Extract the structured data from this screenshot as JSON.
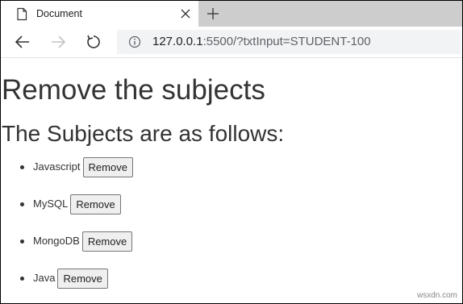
{
  "browser": {
    "tab": {
      "title": "Document"
    },
    "address_bar": {
      "url_host": "127.0.0.1",
      "url_rest": ":5500/?txtInput=STUDENT-100"
    },
    "icons": {
      "favicon": "document-icon",
      "close": "close-icon",
      "new_tab": "plus-icon",
      "back": "arrow-left-icon",
      "forward": "arrow-right-icon",
      "reload": "reload-icon",
      "info": "info-icon"
    }
  },
  "page": {
    "heading": "Remove the subjects",
    "subheading": "The Subjects are as follows:",
    "subjects": [
      {
        "name": "Javascript",
        "button_label": "Remove"
      },
      {
        "name": "MySQL",
        "button_label": "Remove"
      },
      {
        "name": "MongoDB",
        "button_label": "Remove"
      },
      {
        "name": "Java",
        "button_label": "Remove"
      }
    ]
  },
  "watermark": "wsxdn.com"
}
